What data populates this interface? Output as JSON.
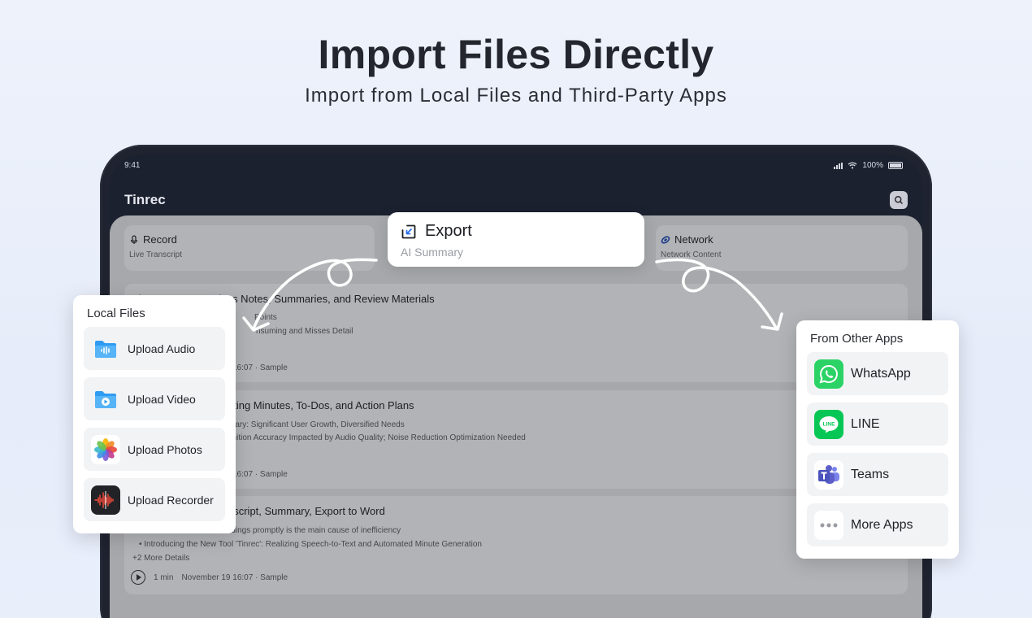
{
  "hero": {
    "title": "Import Files Directly",
    "subtitle": "Import from Local Files and Third-Party Apps"
  },
  "status": {
    "time": "9:41",
    "battery": "100%"
  },
  "app": {
    "title": "Tinrec"
  },
  "modes": [
    {
      "label": "Record",
      "sub": "Live Transcript",
      "icon": "microphone-icon"
    },
    {
      "label": "Network",
      "sub": "Network Content",
      "icon": "link-icon"
    }
  ],
  "export": {
    "label": "Export",
    "sub": "AI Summary",
    "icon": "export-icon",
    "accent": "#2a6ff0"
  },
  "notes": [
    {
      "title": "Tinrec:Generate Class Notes, Summaries, and Review Materials",
      "lines": [
        "Points",
        "nsuming and Misses Detail"
      ],
      "meta": "16:07 · Sample"
    },
    {
      "title": "eting Minutes, To-Dos, and Action Plans",
      "lines": [
        "mary: Significant User Growth, Diversified Needs",
        "gnition Accuracy Impacted by Audio Quality; Noise Reduction Optimization Needed"
      ],
      "meta": "16:07 · Sample"
    },
    {
      "title": "nscript, Summary, Export to Word",
      "lines": [
        "rdings promptly is the main cause of inefficiency",
        "• Introducing the New Tool 'Tinrec': Realizing Speech-to-Text and Automated Minute Generation",
        "+2 More Details"
      ],
      "duration": "1 min",
      "meta": "November 19 16:07 · Sample"
    }
  ],
  "local_files": {
    "title": "Local Files",
    "items": [
      {
        "label": "Upload Audio",
        "icon": "audio-folder-icon"
      },
      {
        "label": "Upload Video",
        "icon": "video-folder-icon"
      },
      {
        "label": "Upload Photos",
        "icon": "photos-icon"
      },
      {
        "label": "Upload Recorder",
        "icon": "voice-recorder-icon"
      }
    ]
  },
  "other_apps": {
    "title": "From Other Apps",
    "items": [
      {
        "label": "WhatsApp",
        "icon": "whatsapp-icon",
        "color": "#2bd366"
      },
      {
        "label": "LINE",
        "icon": "line-icon",
        "color": "#06c755"
      },
      {
        "label": "Teams",
        "icon": "teams-icon",
        "color": "#5b5fc7"
      },
      {
        "label": "More Apps",
        "icon": "more-icon",
        "color": "#9a9ca3"
      }
    ]
  }
}
